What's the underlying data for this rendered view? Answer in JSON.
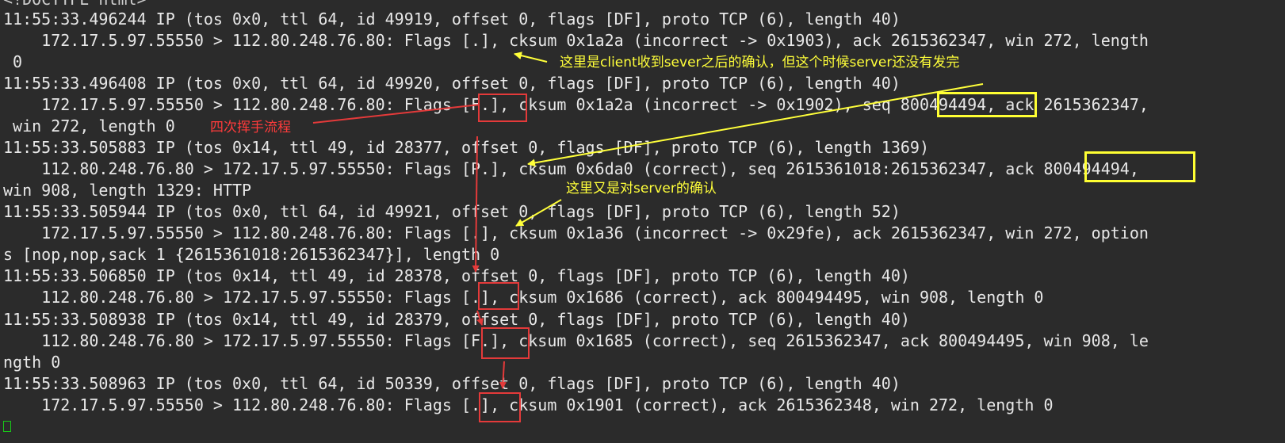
{
  "terminal": {
    "partial_top_line": "<!DOCTYPE html>",
    "lines": [
      "11:55:33.496244 IP (tos 0x0, ttl 64, id 49919, offset 0, flags [DF], proto TCP (6), length 40)",
      "    172.17.5.97.55550 > 112.80.248.76.80: Flags [.], cksum 0x1a2a (incorrect -> 0x1903), ack 2615362347, win 272, length",
      " 0",
      "11:55:33.496408 IP (tos 0x0, ttl 64, id 49920, offset 0, flags [DF], proto TCP (6), length 40)",
      "    172.17.5.97.55550 > 112.80.248.76.80: Flags [F.], cksum 0x1a2a (incorrect -> 0x1902), seq 800494494, ack 2615362347,",
      " win 272, length 0",
      "11:55:33.505883 IP (tos 0x14, ttl 49, id 28377, offset 0, flags [DF], proto TCP (6), length 1369)",
      "    112.80.248.76.80 > 172.17.5.97.55550: Flags [P.], cksum 0x6da0 (correct), seq 2615361018:2615362347, ack 800494494,",
      "win 908, length 1329: HTTP",
      "11:55:33.505944 IP (tos 0x0, ttl 64, id 49921, offset 0, flags [DF], proto TCP (6), length 52)",
      "    172.17.5.97.55550 > 112.80.248.76.80: Flags [.], cksum 0x1a36 (incorrect -> 0x29fe), ack 2615362347, win 272, option",
      "s [nop,nop,sack 1 {2615361018:2615362347}], length 0",
      "11:55:33.506850 IP (tos 0x14, ttl 49, id 28378, offset 0, flags [DF], proto TCP (6), length 40)",
      "    112.80.248.76.80 > 172.17.5.97.55550: Flags [.], cksum 0x1686 (correct), ack 800494495, win 908, length 0",
      "11:55:33.508938 IP (tos 0x14, ttl 49, id 28379, offset 0, flags [DF], proto TCP (6), length 40)",
      "    112.80.248.76.80 > 172.17.5.97.55550: Flags [F.], cksum 0x1685 (correct), seq 2615362347, ack 800494495, win 908, le",
      "ngth 0",
      "11:55:33.508963 IP (tos 0x0, ttl 64, id 50339, offset 0, flags [DF], proto TCP (6), length 40)",
      "    172.17.5.97.55550 > 112.80.248.76.80: Flags [.], cksum 0x1901 (correct), ack 2615362348, win 272, length 0"
    ]
  },
  "annotations": {
    "client_ack_note": "这里是client收到sever之后的确认，但这个时候server还没有发完",
    "four_way_note": "四次挥手流程",
    "server_ack_note": "这里又是对server的确认"
  },
  "colors": {
    "background": "#2b2b2b",
    "text": "#e8e8e8",
    "annotation_yellow": "#ffff3a",
    "annotation_red": "#e43a3a",
    "cursor": "#18c818"
  },
  "icons": {
    "cursor": "terminal-cursor-icon"
  }
}
